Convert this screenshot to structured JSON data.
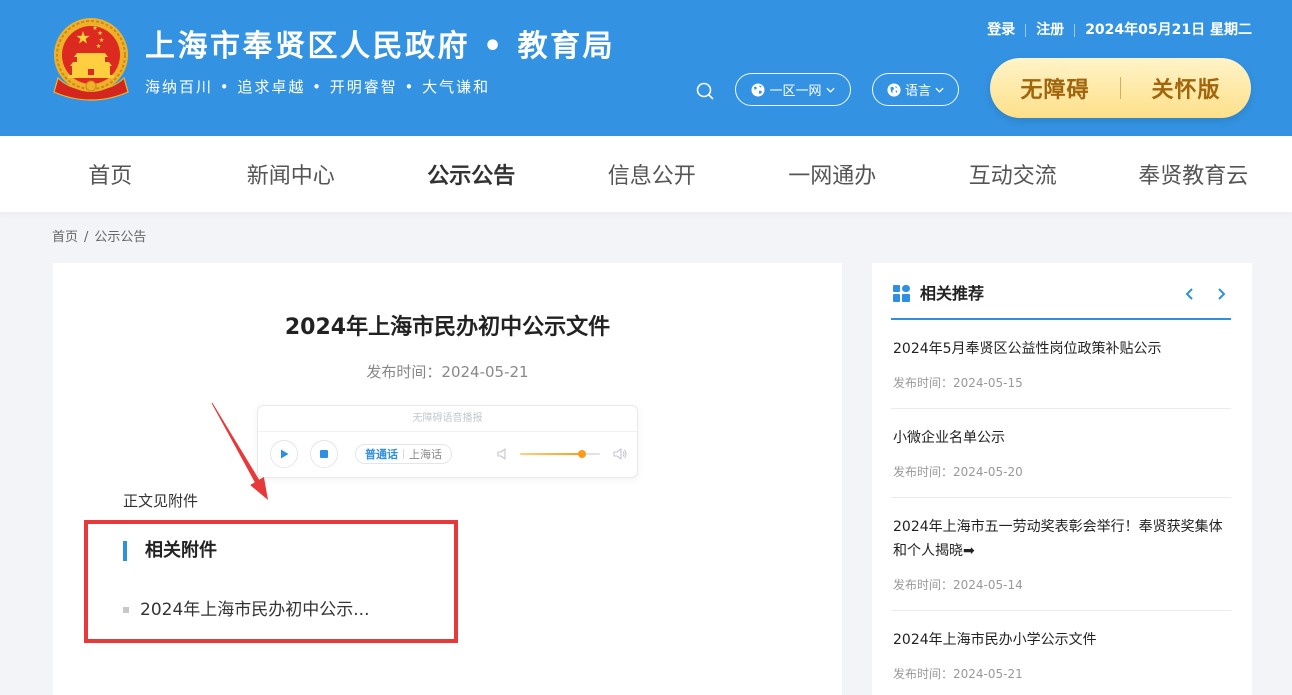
{
  "colors": {
    "header_bg": "#3393e2",
    "accent": "#2f8fe0",
    "care_button_text": "#a0650d",
    "annotation_red": "#e8393a"
  },
  "header": {
    "logo_icon": "national-emblem-icon",
    "title": "上海市奉贤区人民政府 • 教育局",
    "subtitle": "海纳百川 • 追求卓越 • 开明睿智 • 大气谦和",
    "top_links": {
      "login": "登录",
      "register": "注册",
      "date": "2024年05月21日 星期二"
    },
    "search_icon": "search-icon",
    "region_select": {
      "label": "一区一网",
      "icon": "globe-icon"
    },
    "language_select": {
      "label": "语言",
      "icon": "language-icon"
    },
    "accessibility_button": "无障碍",
    "care_mode_button": "关怀版"
  },
  "nav": {
    "items": [
      {
        "label": "首页",
        "active": false
      },
      {
        "label": "新闻中心",
        "active": false
      },
      {
        "label": "公示公告",
        "active": true
      },
      {
        "label": "信息公开",
        "active": false
      },
      {
        "label": "一网通办",
        "active": false
      },
      {
        "label": "互动交流",
        "active": false
      },
      {
        "label": "奉贤教育云",
        "active": false
      }
    ]
  },
  "breadcrumb": {
    "home": "首页",
    "separator": "/",
    "current": "公示公告"
  },
  "article": {
    "title": "2024年上海市民办初中公示文件",
    "publish_time": "发布时间：2024-05-21",
    "player": {
      "label": "无障碍语音播报",
      "languages": [
        "普通话",
        "上海话"
      ],
      "active_language": "普通话",
      "volume": 0.78
    },
    "body_text": "正文见附件",
    "attachments": {
      "heading": "相关附件",
      "items": [
        "2024年上海市民办初中公示..."
      ]
    }
  },
  "sidebar": {
    "heading": "相关推荐",
    "items": [
      {
        "title_lines": [
          "2024年5月奉贤区公益性岗位政策补贴公示"
        ],
        "date": "发布时间：2024-05-15"
      },
      {
        "title_lines": [
          "小微企业名单公示"
        ],
        "date": "发布时间：2024-05-20"
      },
      {
        "title_lines": [
          "2024年上海市五一劳动奖表彰会举行！奉贤获奖集体",
          "和个人揭晓➡"
        ],
        "date": "发布时间：2024-05-14"
      },
      {
        "title_lines": [
          "2024年上海市民办小学公示文件"
        ],
        "date": "发布时间：2024-05-21"
      }
    ]
  }
}
